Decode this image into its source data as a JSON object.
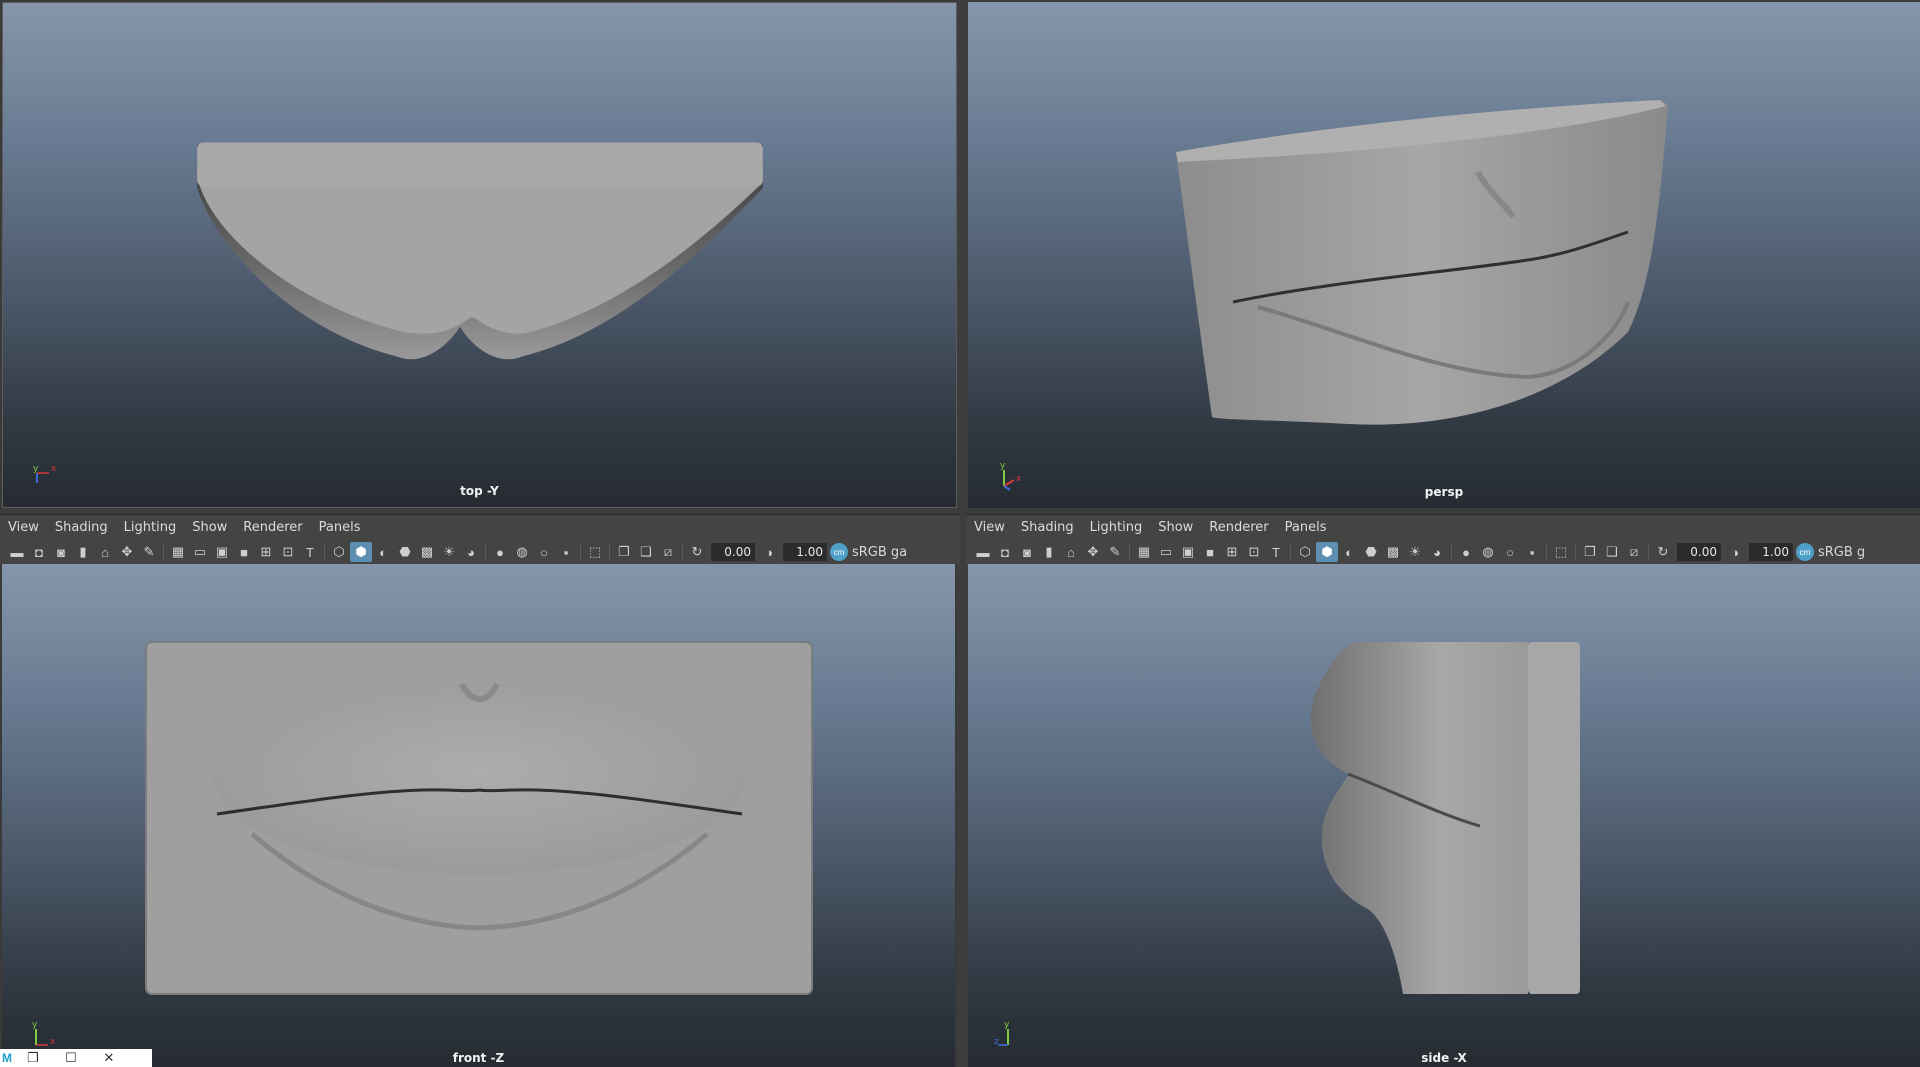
{
  "viewports": {
    "top": {
      "label": "top -Y",
      "axis_labels": [
        "y",
        "x"
      ]
    },
    "persp": {
      "label": "persp",
      "axis_labels": [
        "y",
        "x"
      ]
    },
    "front": {
      "label": "front -Z",
      "axis_labels": [
        "y",
        "x"
      ]
    },
    "side": {
      "label": "side -X",
      "axis_labels": [
        "y",
        "z"
      ]
    }
  },
  "panel_left": {
    "menus": [
      "View",
      "Shading",
      "Lighting",
      "Show",
      "Renderer",
      "Panels"
    ],
    "field_a": "0.00",
    "field_b": "1.00",
    "colorspace": "sRGB ga"
  },
  "panel_right": {
    "menus": [
      "View",
      "Shading",
      "Lighting",
      "Show",
      "Renderer",
      "Panels"
    ],
    "field_a": "0.00",
    "field_b": "1.00",
    "colorspace": "sRGB g"
  },
  "icons": {
    "toolbar": [
      "camera-icon",
      "select-camera-icon",
      "lock-camera-icon",
      "bookmark-icon",
      "image-plane-icon",
      "2d-pan-zoom-icon",
      "grease-pencil-icon",
      "grid-icon",
      "film-gate-icon",
      "resolution-gate-icon",
      "gate-mask-icon",
      "field-chart-icon",
      "safe-action-icon",
      "safe-title-icon",
      "wireframe-icon",
      "smooth-shade-icon",
      "default-material-icon",
      "wireframe-on-shaded-icon",
      "textured-icon",
      "lights-icon",
      "shadows-icon",
      "screen-space-ao-icon",
      "motion-blur-icon",
      "anti-alias-icon",
      "depth-of-field-icon",
      "isolate-select-icon",
      "xray-icon",
      "xray-joints-icon",
      "backface-icon",
      "exposure-icon",
      "gamma-icon",
      "color-management-icon"
    ]
  },
  "window_controls": [
    "maya-icon",
    "restore-icon",
    "maximize-icon",
    "close-icon"
  ],
  "colors": {
    "viewport_top": "#8596ac",
    "viewport_bottom": "#262b31",
    "toolbar_bg": "#444444",
    "active_icon": "#5d8fb0",
    "model_gray": "#9a9a9a"
  }
}
